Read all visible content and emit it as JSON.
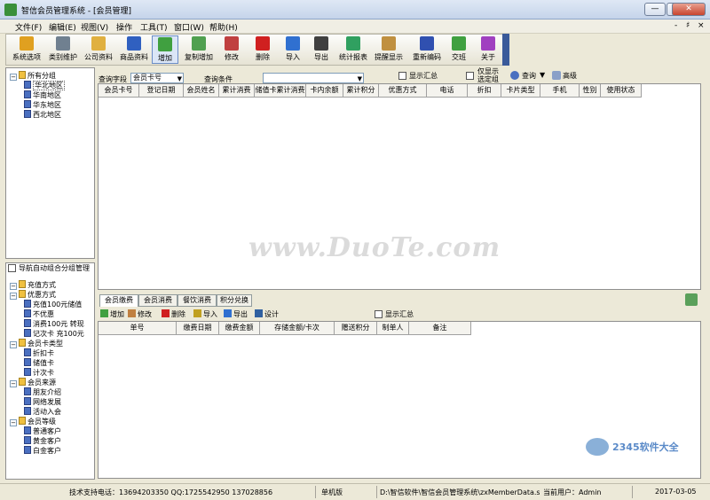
{
  "window": {
    "title": "智信会员管理系统 - [会员管理]"
  },
  "menu": [
    "文件(F)",
    "编辑(E)",
    "视图(V)",
    "操作",
    "工具(T)",
    "窗口(W)",
    "帮助(H)"
  ],
  "mdi_controls": [
    "-",
    "♯",
    "×"
  ],
  "toolbar": [
    {
      "label": "系统选项",
      "icon": "settings-icon",
      "color": "#e0a020"
    },
    {
      "label": "类别维护",
      "icon": "tools-icon",
      "color": "#708090"
    },
    {
      "label": "公司资料",
      "icon": "company-icon",
      "color": "#e0b040"
    },
    {
      "label": "商品资料",
      "icon": "product-icon",
      "color": "#3060c0"
    },
    {
      "label": "增加",
      "icon": "add-user-icon",
      "color": "#40a040"
    },
    {
      "label": "复制增加",
      "icon": "copy-add-icon",
      "color": "#50a050"
    },
    {
      "label": "修改",
      "icon": "edit-icon",
      "color": "#c04040"
    },
    {
      "label": "删除",
      "icon": "delete-icon",
      "color": "#d02020"
    },
    {
      "label": "导入",
      "icon": "import-icon",
      "color": "#3070d0"
    },
    {
      "label": "导出",
      "icon": "export-icon",
      "color": "#404040"
    },
    {
      "label": "统计报表",
      "icon": "report-icon",
      "color": "#30a060"
    },
    {
      "label": "提醒显示",
      "icon": "reminder-icon",
      "color": "#c09040"
    },
    {
      "label": "重新编码",
      "icon": "recode-icon",
      "color": "#3050b0"
    },
    {
      "label": "交班",
      "icon": "handover-icon",
      "color": "#40a040"
    },
    {
      "label": "关于",
      "icon": "help-icon",
      "color": "#a040c0"
    }
  ],
  "tree_regions": {
    "root": "所有分组",
    "items": [
      "华北地区",
      "华南地区",
      "华东地区",
      "西北地区"
    ]
  },
  "tree_nav": {
    "auto_group": "导航自动组合分组管理",
    "sections": [
      {
        "label": "充值方式",
        "children": []
      },
      {
        "label": "优惠方式",
        "children": [
          "充值100元储值",
          "不优惠",
          "消费100元 转现",
          "记次卡 充100元"
        ]
      },
      {
        "label": "会员卡类型",
        "children": [
          "折扣卡",
          "储值卡",
          "计次卡"
        ]
      },
      {
        "label": "会员来源",
        "children": [
          "朋友介绍",
          "网络发展",
          "活动入会"
        ]
      },
      {
        "label": "会员等级",
        "children": [
          "普通客户",
          "黄金客户",
          "白金客户"
        ]
      }
    ]
  },
  "query": {
    "field_label": "查询字段",
    "field_value": "会员卡号",
    "cond_label": "查询条件",
    "cond_value": "",
    "show_summary": "显示汇总",
    "only_selected": "仅显示选定组",
    "search": "查询",
    "advanced": "高级"
  },
  "main_columns": [
    "会员卡号",
    "登记日期",
    "会员姓名",
    "累计消费",
    "储值卡累计消费",
    "卡内余额",
    "累计积分",
    "优惠方式",
    "电话",
    "折扣",
    "卡片类型",
    "手机",
    "性别",
    "使用状态"
  ],
  "tabs": [
    "会员缴费",
    "会员消费",
    "餐饮消费",
    "积分兑换"
  ],
  "sub_toolbar": [
    {
      "label": "增加",
      "icon": "add-icon",
      "color": "#40a040"
    },
    {
      "label": "修改",
      "icon": "edit-icon",
      "color": "#c08040"
    },
    {
      "label": "删除",
      "icon": "delete-icon",
      "color": "#d02020"
    },
    {
      "label": "导入",
      "icon": "import-icon",
      "color": "#c0a020"
    },
    {
      "label": "导出",
      "icon": "export-icon",
      "color": "#3070d0"
    },
    {
      "label": "设计",
      "icon": "design-icon",
      "color": "#3060a0"
    }
  ],
  "sub_show_summary": "显示汇总",
  "fee_columns": [
    "单号",
    "缴费日期",
    "缴费金额",
    "存储金额/卡次",
    "赠送积分",
    "制单人",
    "备注"
  ],
  "status": {
    "support": "技术支持电话：13694203350 QQ:1725542950 137028856",
    "mode": "单机版",
    "path": "D:\\智信软件\\智信会员管理系统\\zxMemberData.sys",
    "user": "当前用户：Admin",
    "date": "2017-03-05"
  },
  "watermark": "www.DuoTe.com",
  "corner_logo": "2345软件大全"
}
